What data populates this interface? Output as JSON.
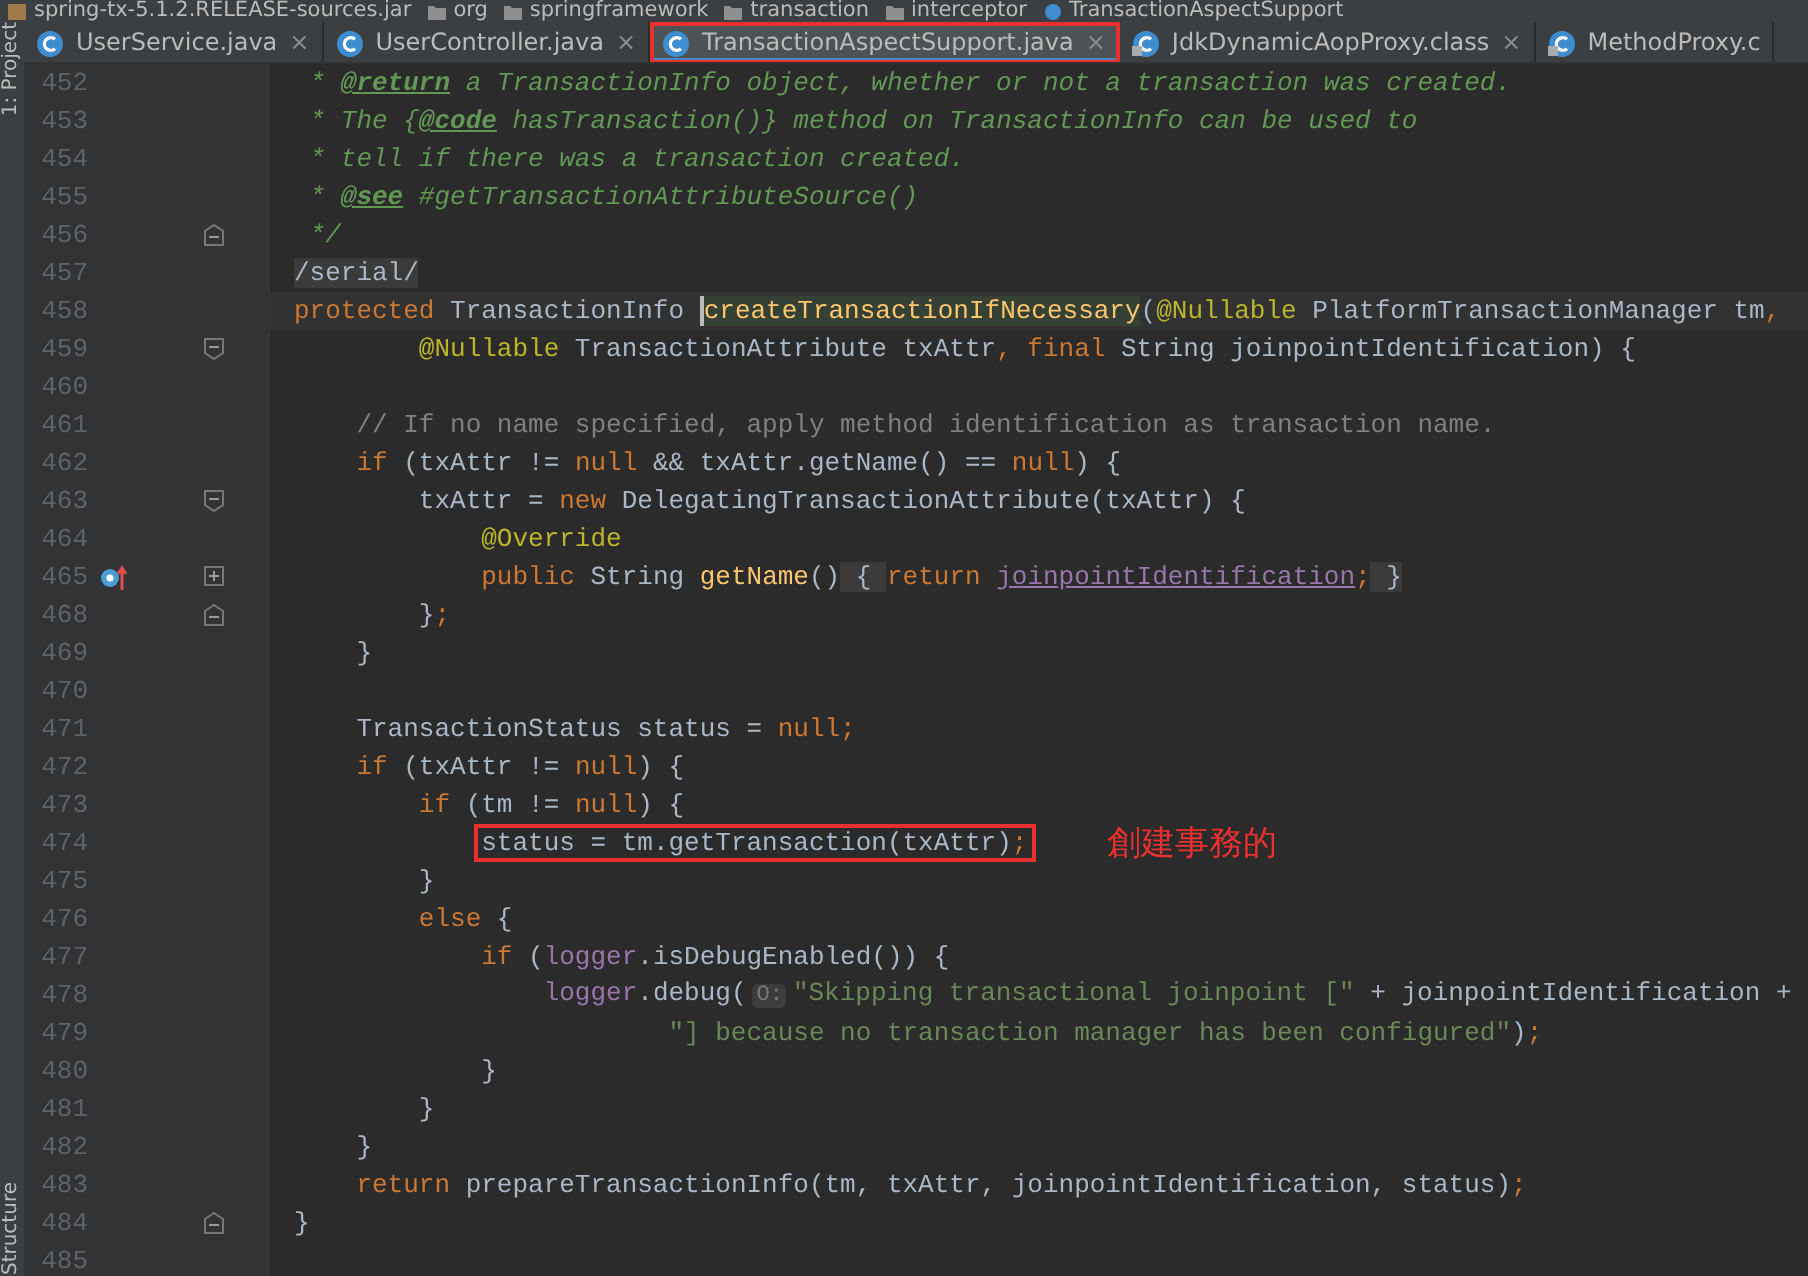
{
  "breadcrumb": [
    {
      "kind": "jar",
      "text": "spring-tx-5.1.2.RELEASE-sources.jar"
    },
    {
      "kind": "package",
      "text": "org"
    },
    {
      "kind": "package",
      "text": "springframework"
    },
    {
      "kind": "package",
      "text": "transaction"
    },
    {
      "kind": "package",
      "text": "interceptor"
    },
    {
      "kind": "class",
      "text": "TransactionAspectSupport"
    }
  ],
  "tool_strip": {
    "top_label": "1: Project",
    "bottom_label": "Structure"
  },
  "tabs": [
    {
      "label": "UserService.java",
      "kind": "class",
      "selected": false,
      "highlighted": false,
      "close": "×"
    },
    {
      "label": "UserController.java",
      "kind": "class",
      "selected": false,
      "highlighted": false,
      "close": "×"
    },
    {
      "label": "TransactionAspectSupport.java",
      "kind": "class",
      "selected": true,
      "highlighted": true,
      "close": "×"
    },
    {
      "label": "JdkDynamicAopProxy.class",
      "kind": "compiled",
      "selected": false,
      "highlighted": false,
      "close": "×"
    },
    {
      "label": "MethodProxy.c",
      "kind": "compiled",
      "selected": false,
      "highlighted": false
    }
  ],
  "lines": [
    {
      "number": "452",
      "tokens": [
        {
          "kind": "doc",
          "text": " * "
        },
        {
          "kind": "doc-tag",
          "text": "@return"
        },
        {
          "kind": "doc",
          "text": " a TransactionInfo object, whether or not a transaction was created."
        }
      ]
    },
    {
      "number": "453",
      "tokens": [
        {
          "kind": "doc",
          "text": " * The {"
        },
        {
          "kind": "doc-tag",
          "text": "@code"
        },
        {
          "kind": "doc",
          "text": " hasTransaction()} method on TransactionInfo can be used to"
        }
      ]
    },
    {
      "number": "454",
      "tokens": [
        {
          "kind": "doc",
          "text": " * tell if there was a transaction created."
        }
      ]
    },
    {
      "number": "455",
      "tokens": [
        {
          "kind": "doc",
          "text": " * "
        },
        {
          "kind": "doc-tag",
          "text": "@see"
        },
        {
          "kind": "doc",
          "text": " #getTransactionAttributeSource()"
        }
      ]
    },
    {
      "number": "456",
      "gutter": [
        {
          "kind": "fold-end"
        }
      ],
      "tokens": [
        {
          "kind": "doc",
          "text": " */"
        }
      ]
    },
    {
      "number": "457",
      "tokens": [
        {
          "kind": "folded",
          "text": "/serial/"
        }
      ]
    },
    {
      "number": "458",
      "current": true,
      "tokens": [
        {
          "kind": "keyword",
          "text": "protected"
        },
        {
          "kind": "plain",
          "text": " TransactionInfo "
        },
        {
          "kind": "method",
          "text": "createTransactionIfNecessary",
          "caret": true
        },
        {
          "kind": "plain",
          "text": "("
        },
        {
          "kind": "annotation",
          "text": "@Nullable"
        },
        {
          "kind": "plain",
          "text": " PlatformTransactionManager tm"
        },
        {
          "kind": "keyword",
          "text": ","
        }
      ]
    },
    {
      "number": "459",
      "gutter": [
        {
          "kind": "fold-start"
        }
      ],
      "tokens": [
        {
          "kind": "annotation",
          "text": "        @Nullable"
        },
        {
          "kind": "plain",
          "text": " TransactionAttribute txAttr"
        },
        {
          "kind": "keyword",
          "text": ", final"
        },
        {
          "kind": "plain",
          "text": " String joinpointIdentification) {"
        }
      ]
    },
    {
      "number": "460"
    },
    {
      "number": "461",
      "tokens": [
        {
          "kind": "comment",
          "text": "    // If no name specified, apply method identification as transaction name."
        }
      ]
    },
    {
      "number": "462",
      "tokens": [
        {
          "kind": "keyword",
          "text": "    if"
        },
        {
          "kind": "plain",
          "text": " (txAttr != "
        },
        {
          "kind": "keyword",
          "text": "null"
        },
        {
          "kind": "plain",
          "text": " && txAttr.getName() == "
        },
        {
          "kind": "keyword",
          "text": "null"
        },
        {
          "kind": "plain",
          "text": ") {"
        }
      ]
    },
    {
      "number": "463",
      "gutter": [
        {
          "kind": "fold-start"
        }
      ],
      "tokens": [
        {
          "kind": "plain",
          "text": "        txAttr = "
        },
        {
          "kind": "keyword",
          "text": "new"
        },
        {
          "kind": "plain",
          "text": " DelegatingTransactionAttribute(txAttr) {"
        }
      ]
    },
    {
      "number": "464",
      "tokens": [
        {
          "kind": "annotation",
          "text": "            @Override"
        }
      ]
    },
    {
      "number": "465",
      "gutter": [
        {
          "kind": "override"
        },
        {
          "kind": "fold-expand"
        }
      ],
      "tokens": [
        {
          "kind": "keyword",
          "text": "            public"
        },
        {
          "kind": "plain",
          "text": " String "
        },
        {
          "kind": "method",
          "text": "getName"
        },
        {
          "kind": "plain",
          "text": "()"
        },
        {
          "kind": "folded",
          "text": " { "
        },
        {
          "kind": "keyword",
          "text": "return "
        },
        {
          "kind": "field-link",
          "text": "joinpointIdentification"
        },
        {
          "kind": "keyword",
          "text": ";"
        },
        {
          "kind": "folded",
          "text": " }"
        }
      ]
    },
    {
      "number": "468",
      "gutter": [
        {
          "kind": "fold-end"
        }
      ],
      "tokens": [
        {
          "kind": "plain",
          "text": "        }"
        },
        {
          "kind": "keyword",
          "text": ";"
        }
      ]
    },
    {
      "number": "469",
      "tokens": [
        {
          "kind": "plain",
          "text": "    }"
        }
      ]
    },
    {
      "number": "470"
    },
    {
      "number": "471",
      "tokens": [
        {
          "kind": "plain",
          "text": "    TransactionStatus status = "
        },
        {
          "kind": "keyword",
          "text": "null;"
        }
      ]
    },
    {
      "number": "472",
      "tokens": [
        {
          "kind": "keyword",
          "text": "    if"
        },
        {
          "kind": "plain",
          "text": " (txAttr != "
        },
        {
          "kind": "keyword",
          "text": "null"
        },
        {
          "kind": "plain",
          "text": ") {"
        }
      ]
    },
    {
      "number": "473",
      "tokens": [
        {
          "kind": "keyword",
          "text": "        if"
        },
        {
          "kind": "plain",
          "text": " (tm != "
        },
        {
          "kind": "keyword",
          "text": "null"
        },
        {
          "kind": "plain",
          "text": ") {"
        }
      ]
    },
    {
      "number": "474",
      "boxed": true,
      "note": "創建事務的",
      "tokens": [
        {
          "kind": "plain",
          "text": "            status = tm.getTransaction(txAttr)"
        },
        {
          "kind": "keyword",
          "text": ";"
        }
      ]
    },
    {
      "number": "475",
      "tokens": [
        {
          "kind": "plain",
          "text": "        }"
        }
      ]
    },
    {
      "number": "476",
      "tokens": [
        {
          "kind": "keyword",
          "text": "        else"
        },
        {
          "kind": "plain",
          "text": " {"
        }
      ]
    },
    {
      "number": "477",
      "tokens": [
        {
          "kind": "keyword",
          "text": "            if"
        },
        {
          "kind": "plain",
          "text": " ("
        },
        {
          "kind": "field",
          "text": "logger"
        },
        {
          "kind": "plain",
          "text": ".isDebugEnabled()) {"
        }
      ]
    },
    {
      "number": "478",
      "tokens": [
        {
          "kind": "field",
          "text": "                logger"
        },
        {
          "kind": "plain",
          "text": ".debug("
        },
        {
          "kind": "hint",
          "text": "O:"
        },
        {
          "kind": "string",
          "text": "\"Skipping transactional joinpoint [\""
        },
        {
          "kind": "plain",
          "text": " + joinpointIdentification +"
        }
      ]
    },
    {
      "number": "479",
      "tokens": [
        {
          "kind": "string",
          "text": "                        \"] because no transaction manager has been configured\""
        },
        {
          "kind": "plain",
          "text": ")"
        },
        {
          "kind": "keyword",
          "text": ";"
        }
      ]
    },
    {
      "number": "480",
      "tokens": [
        {
          "kind": "plain",
          "text": "            }"
        }
      ]
    },
    {
      "number": "481",
      "tokens": [
        {
          "kind": "plain",
          "text": "        }"
        }
      ]
    },
    {
      "number": "482",
      "tokens": [
        {
          "kind": "plain",
          "text": "    }"
        }
      ]
    },
    {
      "number": "483",
      "tokens": [
        {
          "kind": "keyword",
          "text": "    return"
        },
        {
          "kind": "plain",
          "text": " prepareTransactionInfo(tm, txAttr, joinpointIdentification, status)"
        },
        {
          "kind": "keyword",
          "text": ";"
        }
      ]
    },
    {
      "number": "484",
      "gutter": [
        {
          "kind": "fold-end"
        }
      ],
      "tokens": [
        {
          "kind": "plain",
          "text": "}"
        }
      ]
    },
    {
      "number": "485"
    }
  ]
}
